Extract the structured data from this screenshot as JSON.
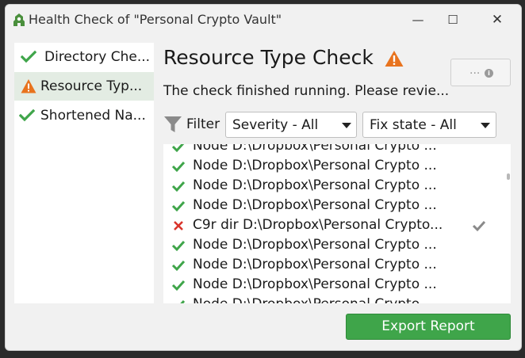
{
  "window": {
    "title": "Health Check of \"Personal Crypto Vault\"",
    "controls": {
      "minimize": "—",
      "maximize": "☐",
      "close": "✕"
    }
  },
  "sidebar": {
    "items": [
      {
        "label": "Directory Che...",
        "status": "ok",
        "icon": "check-icon"
      },
      {
        "label": "Resource Typ...",
        "status": "warning",
        "icon": "warning-icon",
        "selected": true
      },
      {
        "label": "Shortened Na...",
        "status": "ok",
        "icon": "check-icon"
      }
    ]
  },
  "main": {
    "heading": "Resource Type Check",
    "heading_status": "warning",
    "description": "The check finished running. Please revie...",
    "info_button": "...",
    "filter": {
      "label": "Filter",
      "severity": "Severity - All",
      "fix_state": "Fix state - All"
    },
    "results": [
      {
        "status": "ok",
        "text": "Node D:\\Dropbox\\Personal Crypto ..."
      },
      {
        "status": "ok",
        "text": "Node D:\\Dropbox\\Personal Crypto ..."
      },
      {
        "status": "ok",
        "text": "Node D:\\Dropbox\\Personal Crypto ..."
      },
      {
        "status": "ok",
        "text": "Node D:\\Dropbox\\Personal Crypto ..."
      },
      {
        "status": "error",
        "text": "C9r dir D:\\Dropbox\\Personal Crypto...",
        "fixable": true
      },
      {
        "status": "ok",
        "text": "Node D:\\Dropbox\\Personal Crypto ..."
      },
      {
        "status": "ok",
        "text": "Node D:\\Dropbox\\Personal Crypto ..."
      },
      {
        "status": "ok",
        "text": "Node D:\\Dropbox\\Personal Crypto ..."
      },
      {
        "status": "ok",
        "text": "Node D:\\Dropbox\\Personal Crypto ..."
      }
    ],
    "export_button": "Export Report"
  },
  "colors": {
    "ok": "#3fa54a",
    "warning": "#e8731e",
    "error": "#d9342b",
    "accent": "#3fa54a"
  }
}
